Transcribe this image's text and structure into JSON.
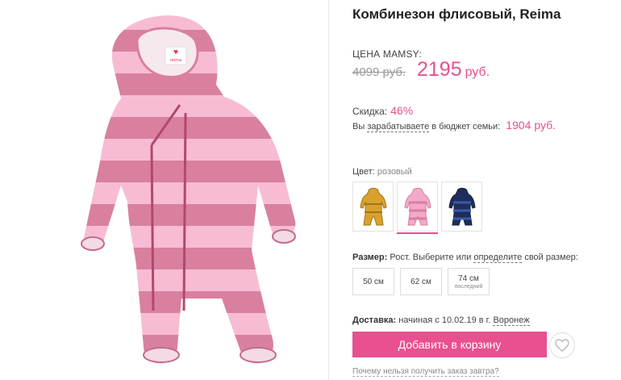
{
  "product": {
    "title": "Комбинезон флисовый, Reima",
    "brand_tag": "reima"
  },
  "price": {
    "label": "ЦЕНА MAMSY:",
    "old": "4099 руб.",
    "new_value": "2195",
    "new_currency": "руб."
  },
  "discount": {
    "label": "Скидка:",
    "value": "46%"
  },
  "earn": {
    "prefix": "Вы",
    "link": "зарабатываете",
    "suffix": "в бюджет семьи:",
    "amount": "1904 руб."
  },
  "color": {
    "label": "Цвет:",
    "value": "розовый",
    "swatches": [
      {
        "name": "mustard",
        "color": "#d9a12c",
        "stripe": "#b07d19"
      },
      {
        "name": "pink",
        "color": "#f2aac8",
        "stripe": "#d67fa2"
      },
      {
        "name": "navy",
        "color": "#1f2d5c",
        "stripe": "#3c5ba8"
      }
    ]
  },
  "size": {
    "label": "Размер:",
    "text_before": "Рост. Выберите или",
    "link": "определите",
    "text_after": "свой размер:",
    "options": [
      {
        "label": "50 см",
        "sub": ""
      },
      {
        "label": "62 см",
        "sub": ""
      },
      {
        "label": "74 см",
        "sub": "последний"
      }
    ]
  },
  "delivery": {
    "label": "Доставка:",
    "text": "начиная с 10.02.19 в г.",
    "city": "Воронеж"
  },
  "cart_button": "Добавить в корзину",
  "why_link": "Почему нельзя получить заказ завтра?",
  "colors": {
    "accent": "#e8508f",
    "pink_light": "#f7bcd3",
    "pink_dark": "#d9809f"
  }
}
